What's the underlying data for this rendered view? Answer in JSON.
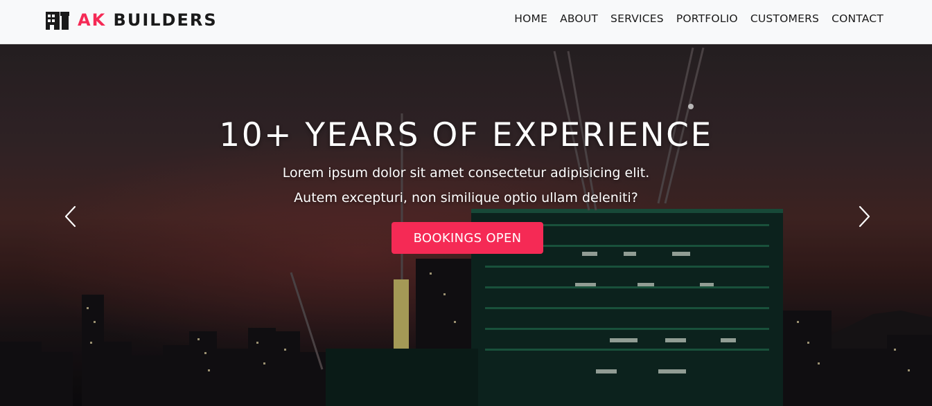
{
  "navbar": {
    "brand": {
      "icon": "building-icon",
      "accent": "AK",
      "name": "BUILDERS"
    },
    "links": [
      {
        "label": "HOME"
      },
      {
        "label": "ABOUT"
      },
      {
        "label": "SERVICES"
      },
      {
        "label": "PORTFOLIO"
      },
      {
        "label": "CUSTOMERS"
      },
      {
        "label": "CONTACT"
      }
    ]
  },
  "hero": {
    "title": "10+ YEARS OF EXPERIENCE",
    "line1": "Lorem ipsum dolor sit amet consectetur adipisicing elit.",
    "line2": "Autem excepturi, non similique optio ullam deleniti?",
    "cta_label": "BOOKINGS OPEN",
    "prev_icon": "chevron-left-icon",
    "next_icon": "chevron-right-icon"
  },
  "colors": {
    "accent": "#f52a55",
    "navbar_bg": "#f8f9fa",
    "text_dark": "#1a1a1a"
  }
}
